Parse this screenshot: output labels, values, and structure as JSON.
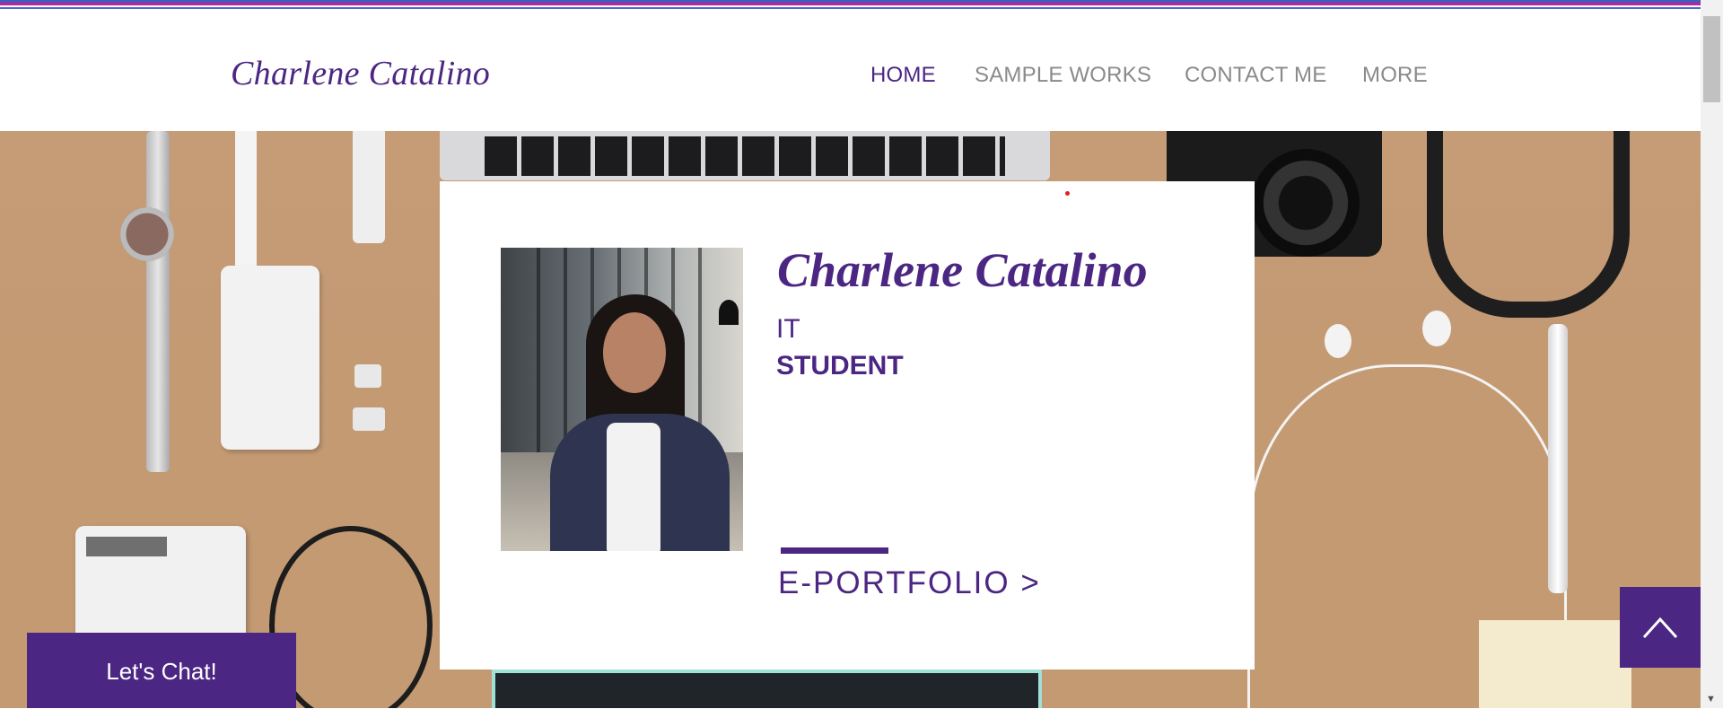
{
  "header": {
    "logo_text": "Charlene Catalino",
    "nav": [
      {
        "label": "HOME",
        "active": true
      },
      {
        "label": "SAMPLE WORKS",
        "active": false
      },
      {
        "label": "CONTACT ME",
        "active": false
      },
      {
        "label": "MORE",
        "active": false
      }
    ]
  },
  "hero": {
    "card": {
      "name": "Charlene Catalino",
      "role_line1": "IT",
      "role_line2": "STUDENT",
      "portfolio_link": "E-PORTFOLIO >"
    }
  },
  "chat": {
    "label": "Let's Chat!"
  },
  "back_to_top": {
    "icon": "chevron-up-icon"
  },
  "colors": {
    "accent": "#4b2683",
    "nav_inactive": "#8a8a8a",
    "stripe_blue": "#3b5fc0",
    "stripe_magenta": "#c5208f",
    "hero_background": "#c59c76"
  }
}
